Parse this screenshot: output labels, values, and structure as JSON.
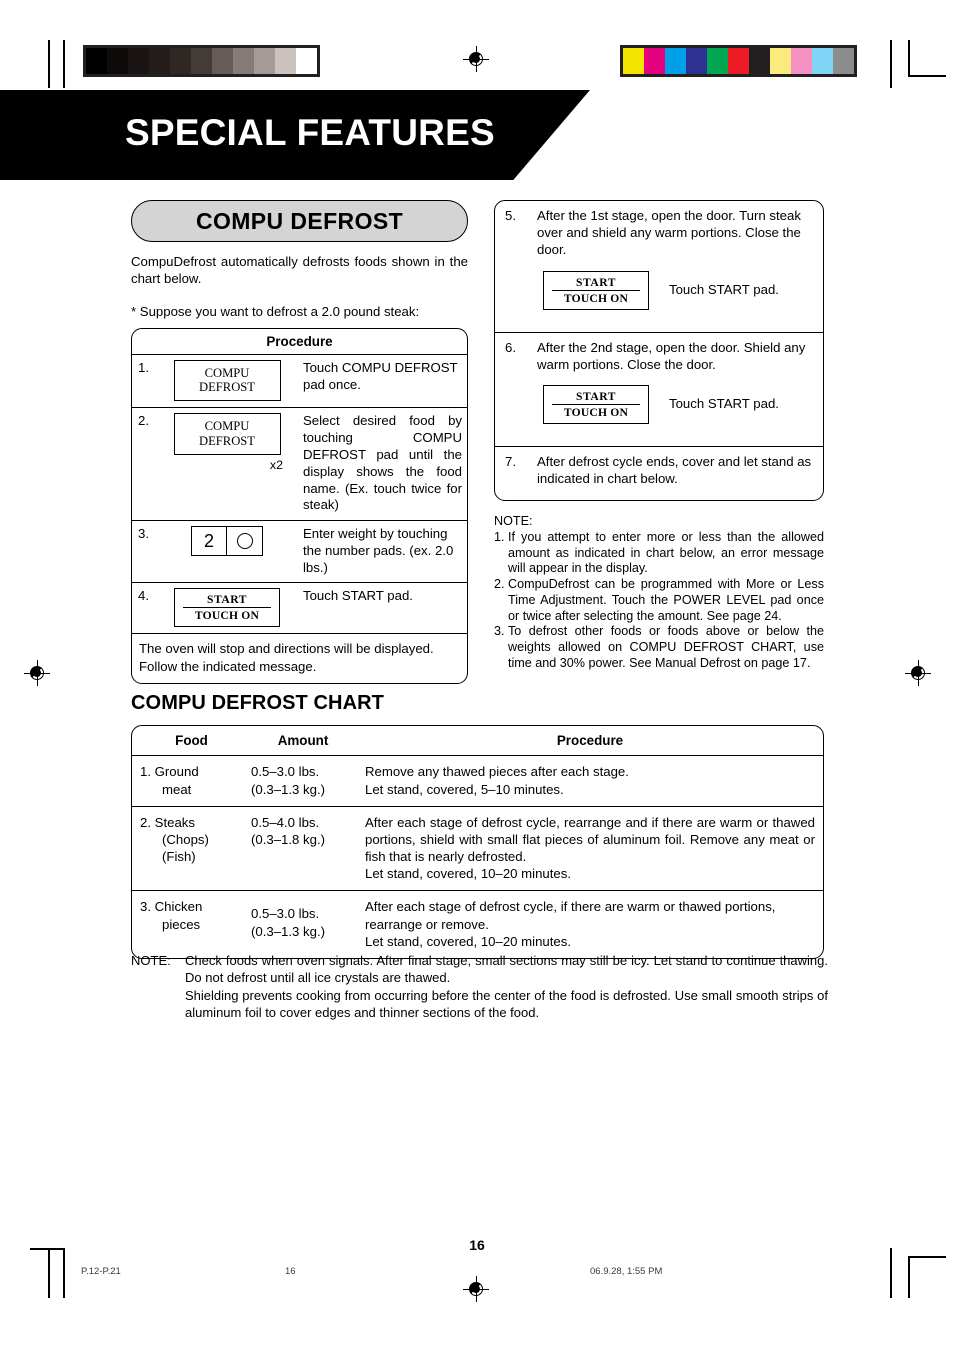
{
  "header": {
    "banner_title": "SPECIAL FEATURES"
  },
  "print_marks": {
    "grayscale_swatches": [
      "#000000",
      "#0e0a0a",
      "#1a1414",
      "#231c1a",
      "#2e2724",
      "#443c38",
      "#665c57",
      "#867b76",
      "#a59b96",
      "#cdc3be",
      "#ffffff"
    ],
    "color_swatches": [
      "#f5e300",
      "#e5007e",
      "#00a0e9",
      "#2e3192",
      "#00a651",
      "#ed1c24",
      "#231f20",
      "#fbeb7e",
      "#f691c4",
      "#80d4f5",
      "#8c8c8c"
    ]
  },
  "left": {
    "pill_title": "COMPU DEFROST",
    "intro": "CompuDefrost automatically defrosts foods shown in the chart below.",
    "suppose": "*  Suppose you  want to defrost a 2.0 pound steak:",
    "procedure_header": "Procedure",
    "steps": [
      {
        "num": "1.",
        "pad_type": "compu",
        "pad_line1": "COMPU",
        "pad_line2": "DEFROST",
        "note": "",
        "text": "Touch COMPU DEFROST  pad once."
      },
      {
        "num": "2.",
        "pad_type": "compu",
        "pad_line1": "COMPU",
        "pad_line2": "DEFROST",
        "note": "x2",
        "text": "Select desired food by touching COMPU DEFROST pad until the display shows the food name. (Ex. touch twice for steak)"
      },
      {
        "num": "3.",
        "pad_type": "numbers",
        "pad_key1": "2",
        "pad_key2": "O",
        "note": "",
        "text": "Enter weight by touching the number pads. (ex. 2.0 lbs.)"
      },
      {
        "num": "4.",
        "pad_type": "start",
        "pad_line1": "START",
        "pad_line2": "TOUCH ON",
        "note": "",
        "text": "Touch START pad."
      }
    ],
    "closing": "The oven will stop and directions will be displayed.\nFollow the indicated message."
  },
  "right": {
    "steps": [
      {
        "num": "5.",
        "text": "After the 1st stage, open the door. Turn steak over and shield any warm portions. Close the door.",
        "pad_line1": "START",
        "pad_line2": "TOUCH ON",
        "pad_caption": "Touch START pad."
      },
      {
        "num": "6.",
        "text": "After the 2nd stage, open the door. Shield any warm portions. Close the door.",
        "pad_line1": "START",
        "pad_line2": "TOUCH ON",
        "pad_caption": "Touch START pad."
      },
      {
        "num": "7.",
        "text": "After defrost cycle ends, cover and let stand as indicated in chart below.",
        "pad_line1": "",
        "pad_line2": "",
        "pad_caption": ""
      }
    ],
    "note_heading": "NOTE:",
    "notes": [
      {
        "idx": "1.",
        "text": "If you attempt to enter more or less than the allowed amount as indicated in chart below, an error message will appear in the display."
      },
      {
        "idx": "2.",
        "text": "CompuDefrost can be programmed with More or Less Time Adjustment. Touch the POWER LEVEL pad once or twice after selecting the amount. See page 24."
      },
      {
        "idx": "3.",
        "text": "To defrost other foods or foods above or below the weights allowed on COMPU DEFROST CHART, use time and 30% power. See Manual Defrost on page 17."
      }
    ]
  },
  "chart": {
    "title": "COMPU DEFROST CHART",
    "columns": [
      "Food",
      "Amount",
      "Procedure"
    ],
    "rows": [
      {
        "food_main": "1. Ground",
        "food_sub": "meat",
        "food_sub2": "",
        "amount_lbs": "0.5–3.0 lbs.",
        "amount_kg": "(0.3–1.3 kg.)",
        "procedure": "Remove any thawed pieces after each stage.\nLet stand, covered, 5–10 minutes."
      },
      {
        "food_main": "2. Steaks",
        "food_sub": "(Chops)",
        "food_sub2": "(Fish)",
        "amount_lbs": "0.5–4.0 lbs.",
        "amount_kg": "(0.3–1.8 kg.)",
        "procedure": "After each stage of defrost cycle, rearrange and if there are warm or thawed portions, shield with small flat pieces of aluminum foil. Remove any meat or fish that is nearly defrosted.\nLet stand, covered, 10–20 minutes."
      },
      {
        "food_main": "3. Chicken",
        "food_sub": "pieces",
        "food_sub2": "",
        "amount_lbs": "0.5–3.0 lbs.",
        "amount_kg": "(0.3–1.3 kg.)",
        "procedure": "After each stage of defrost cycle, if there are warm or thawed portions, rearrange or remove.\nLet stand, covered, 10–20 minutes."
      }
    ]
  },
  "footer_note": {
    "label": "NOTE:",
    "paragraph1": "Check foods when oven signals. After final stage, small sections may still be icy. Let stand to continue thawing. Do not defrost until all ice crystals are thawed.",
    "paragraph2": "Shielding prevents cooking from occurring before the center of the food is defrosted. Use small smooth strips of aluminum foil to cover edges and thinner sections of the food."
  },
  "page": {
    "number": "16",
    "printer_file": "P.12-P.21",
    "printer_page": "16",
    "printer_timestamp": "06.9.28, 1:55 PM"
  }
}
